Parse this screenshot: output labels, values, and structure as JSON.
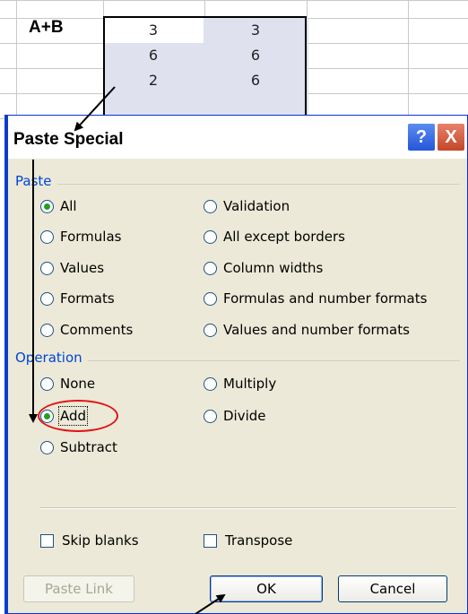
{
  "spreadsheet": {
    "label": "A+B",
    "rows": [
      [
        "3",
        "3"
      ],
      [
        "6",
        "6"
      ],
      [
        "2",
        "6"
      ]
    ]
  },
  "dialog": {
    "title": "Paste Special",
    "help_glyph": "?",
    "close_glyph": "X",
    "paste_group": {
      "label": "Paste",
      "selected": "All",
      "left": [
        "All",
        "Formulas",
        "Values",
        "Formats",
        "Comments"
      ],
      "right": [
        "Validation",
        "All except borders",
        "Column widths",
        "Formulas and number formats",
        "Values and number formats"
      ]
    },
    "operation_group": {
      "label": "Operation",
      "selected": "Add",
      "left": [
        "None",
        "Add",
        "Subtract"
      ],
      "right": [
        "Multiply",
        "Divide"
      ]
    },
    "checkboxes": {
      "skip_blanks": "Skip blanks",
      "transpose": "Transpose"
    },
    "buttons": {
      "paste_link": "Paste Link",
      "ok": "OK",
      "cancel": "Cancel"
    }
  },
  "annotations": {
    "highlight_color": "#e11414",
    "arrow_color": "#000000"
  }
}
